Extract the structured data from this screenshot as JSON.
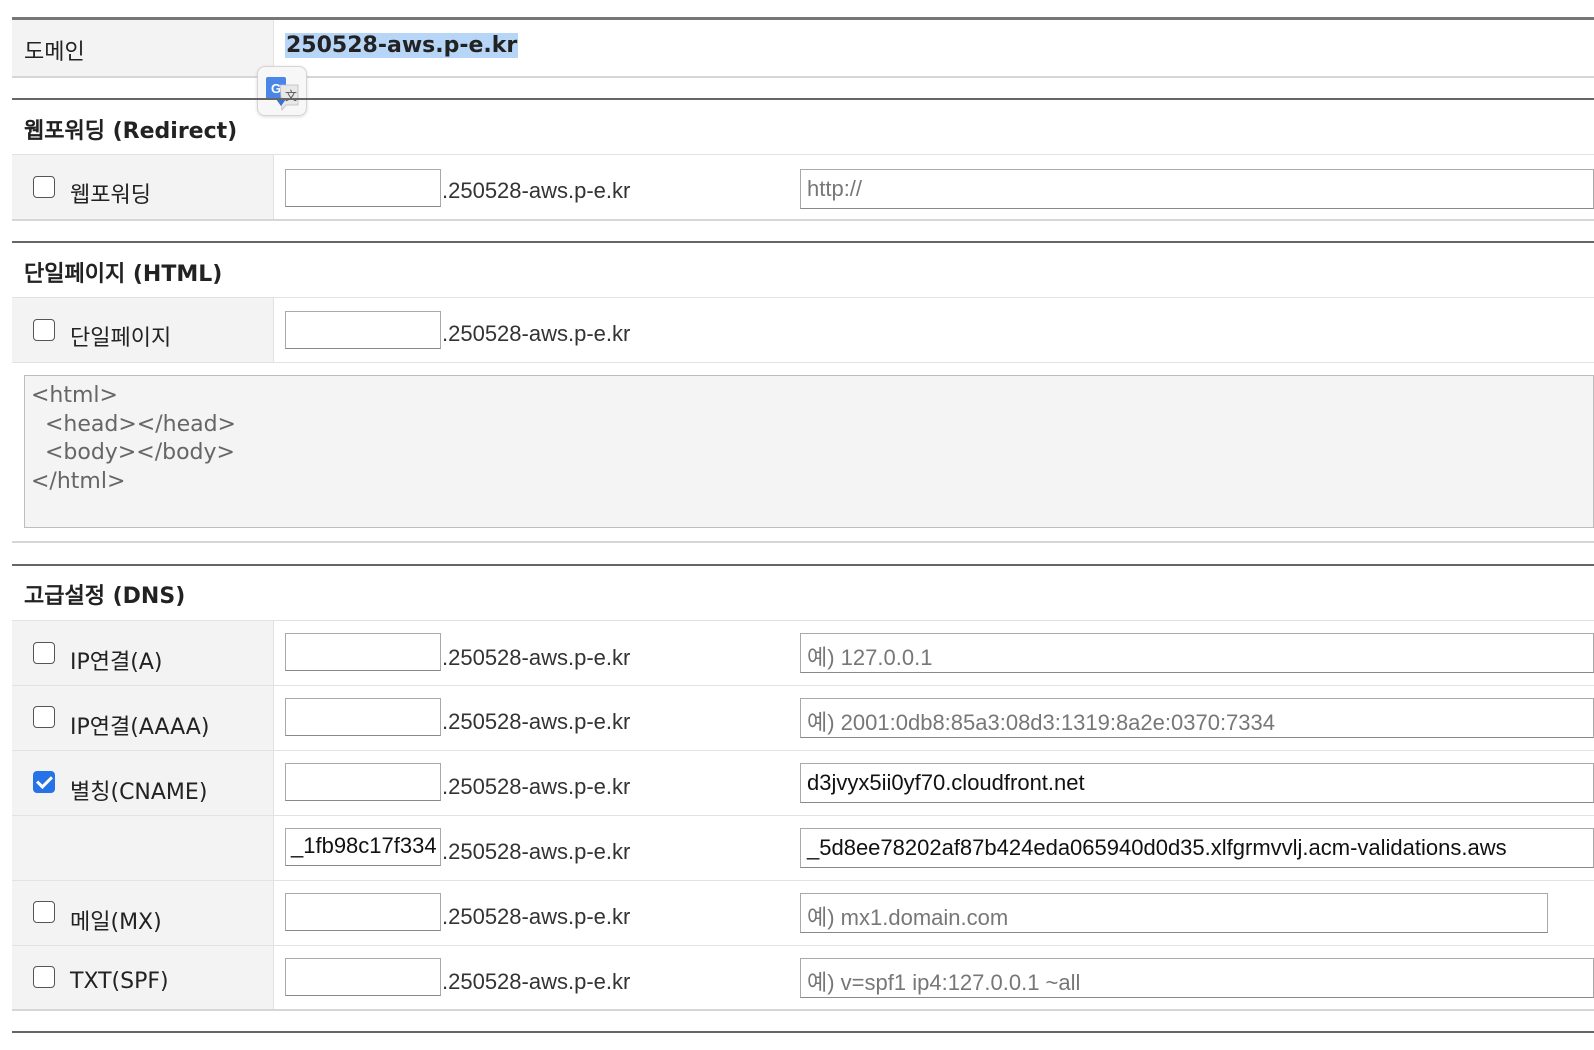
{
  "domain": {
    "label": "도메인",
    "value": "250528-aws.p-e.kr"
  },
  "redirect_section": {
    "title": "웹포워딩 (Redirect)",
    "row": {
      "label": "웹포워딩",
      "checked": false,
      "sub_value": "",
      "suffix": ".250528-aws.p-e.kr",
      "url_value": "http://"
    }
  },
  "html_section": {
    "title": "단일페이지 (HTML)",
    "row": {
      "label": "단일페이지",
      "checked": false,
      "sub_value": "",
      "suffix": ".250528-aws.p-e.kr"
    },
    "html_content": "<html>\n  <head></head>\n  <body></body>\n</html>"
  },
  "dns_section": {
    "title": "고급설정 (DNS)",
    "records": [
      {
        "label": "IP연결(A)",
        "checked": false,
        "sub_value": "",
        "suffix": ".250528-aws.p-e.kr",
        "value": "",
        "placeholder": "예) 127.0.0.1"
      },
      {
        "label": "IP연결(AAAA)",
        "checked": false,
        "sub_value": "",
        "suffix": ".250528-aws.p-e.kr",
        "value": "",
        "placeholder": "예) 2001:0db8:85a3:08d3:1319:8a2e:0370:7334"
      },
      {
        "label": "별칭(CNAME)",
        "checked": true,
        "sub_value": "",
        "suffix": ".250528-aws.p-e.kr",
        "value": "d3jvyx5ii0yf70.cloudfront.net",
        "placeholder": ""
      },
      {
        "label": "",
        "checked": null,
        "sub_value": "_1fb98c17f334",
        "suffix": ".250528-aws.p-e.kr",
        "value": "_5d8ee78202af87b424eda065940d0d35.xlfgrmvvlj.acm-validations.aws",
        "placeholder": ""
      },
      {
        "label": "메일(MX)",
        "checked": false,
        "sub_value": "",
        "suffix": ".250528-aws.p-e.kr",
        "value": "",
        "placeholder": "예) mx1.domain.com"
      },
      {
        "label": "TXT(SPF)",
        "checked": false,
        "sub_value": "",
        "suffix": ".250528-aws.p-e.kr",
        "value": "",
        "placeholder": "예) v=spf1 ip4:127.0.0.1 ~all"
      }
    ]
  },
  "translate_popup": {
    "icon": "google-translate-icon"
  },
  "colors": {
    "label_bg": "#f3f3f3",
    "selection_highlight": "#b7d5f6",
    "checkbox_checked": "#2673e8",
    "section_border": "#666666"
  }
}
